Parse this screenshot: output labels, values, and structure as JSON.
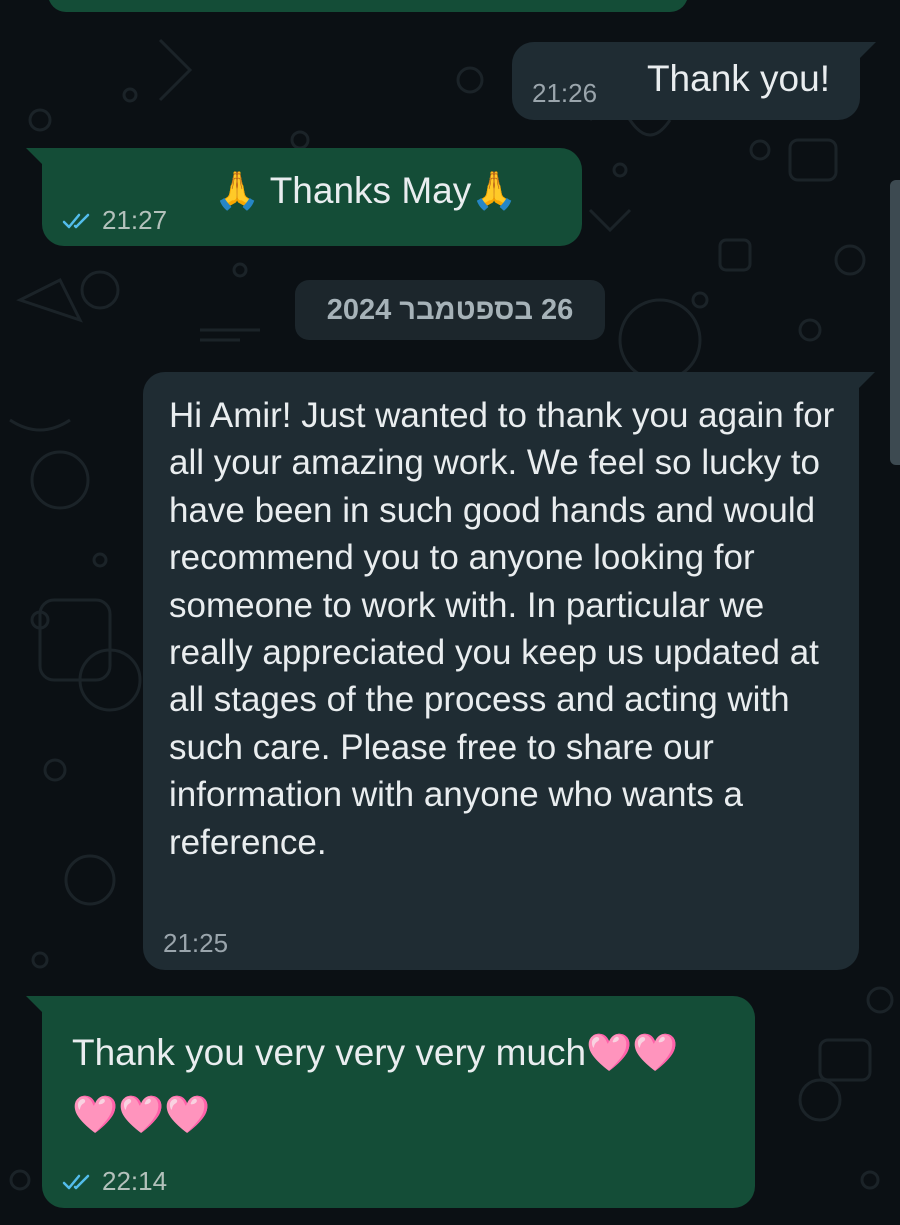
{
  "colors": {
    "background": "#0b1014",
    "outgoing_bubble": "#144d37",
    "incoming_bubble": "#1f2c33",
    "read_receipt": "#53bdeb",
    "message_text": "#e9edef",
    "timestamp": "#9aa5ac"
  },
  "messages": [
    {
      "direction": "incoming",
      "text": "Thank you!",
      "time": "21:26"
    },
    {
      "direction": "outgoing",
      "emoji_before": "🙏",
      "text": "Thanks May",
      "emoji_after": "🙏",
      "time": "21:27",
      "status_icon": "double-check-read-icon"
    },
    {
      "direction": "incoming",
      "text": "Hi Amir! Just wanted to thank you again for all your amazing work. We feel so lucky to have been in such good hands and would recommend you to anyone looking for someone to work with. In particular we really appreciated you keep us updated at all stages of the process and acting with such care. Please free to share our information with anyone who wants a reference.",
      "time": "21:25"
    },
    {
      "direction": "outgoing",
      "text": "Thank you very very very much",
      "emoji": "🩷🩷",
      "emoji_line2": "🩷🩷🩷",
      "time": "22:14",
      "status_icon": "double-check-read-icon"
    }
  ],
  "date_separator": "26 בספטמבר 2024"
}
